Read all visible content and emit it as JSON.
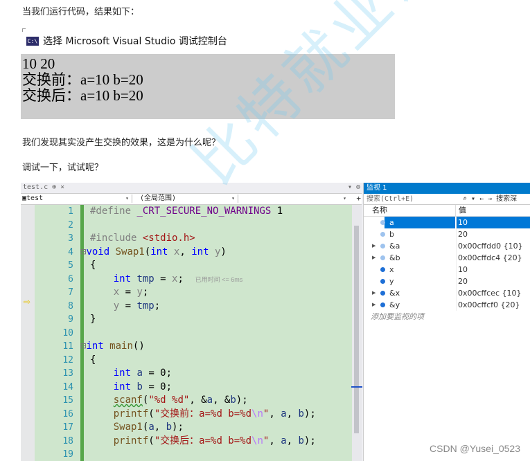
{
  "article": {
    "intro": "当我们运行代码，结果如下：",
    "found": "我们发现其实没产生交换的效果，这是为什么呢？",
    "debug": "调试一下，试试呢？"
  },
  "console": {
    "icon": "C:\\",
    "title": "选择 Microsoft Visual Studio 调试控制台",
    "lines": [
      "10 20",
      "交换前：a=10 b=20",
      "交换后：a=10 b=20"
    ]
  },
  "editor": {
    "tab_label": "test.c",
    "tab_pin": "⊕",
    "tab_close": "×",
    "tab_controls": "▾ ⚙",
    "nav_file": "test",
    "nav_scope": "(全局范围)",
    "nav_func": "",
    "nav_plus": "+",
    "line_numbers": [
      "1",
      "2",
      "3",
      "4",
      "5",
      "6",
      "7",
      "8",
      "9",
      "10",
      "11",
      "12",
      "13",
      "14",
      "15",
      "16",
      "17",
      "18",
      "19"
    ],
    "elapsed_hint": "已用时间 <= 6ms",
    "current_line": 6
  },
  "watch": {
    "title": "监视 1",
    "search_placeholder": "搜索(Ctrl+E)",
    "search_tools": "⌕ ▾  ← →  搜索深",
    "col_name": "名称",
    "col_value": "值",
    "rows": [
      {
        "name": "a",
        "value": "10",
        "expandable": false,
        "selected": true,
        "dim": true
      },
      {
        "name": "b",
        "value": "20",
        "expandable": false,
        "selected": false,
        "dim": true
      },
      {
        "name": "&a",
        "value": "0x00cffdd0 {10}",
        "expandable": true,
        "selected": false,
        "dim": true
      },
      {
        "name": "&b",
        "value": "0x00cffdc4 {20}",
        "expandable": true,
        "selected": false,
        "dim": true
      },
      {
        "name": "x",
        "value": "10",
        "expandable": false,
        "selected": false,
        "dim": false
      },
      {
        "name": "y",
        "value": "20",
        "expandable": false,
        "selected": false,
        "dim": false
      },
      {
        "name": "&x",
        "value": "0x00cffcec {10}",
        "expandable": true,
        "selected": false,
        "dim": false
      },
      {
        "name": "&y",
        "value": "0x00cffcf0 {20}",
        "expandable": true,
        "selected": false,
        "dim": false
      }
    ],
    "add_placeholder": "添加要监视的项"
  },
  "watermark": "比特就业课",
  "credit": "CSDN @Yusei_0523",
  "colors": {
    "accent": "#007acc",
    "code_bg": "#cfe6cd",
    "console_bg": "#cccccc",
    "selection": "#0078d7"
  }
}
